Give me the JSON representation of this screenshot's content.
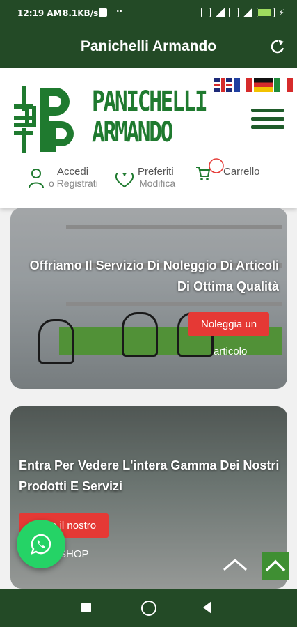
{
  "status_bar": {
    "time": "12:19 AM",
    "speed": "8.1KB/s",
    "dots": "··"
  },
  "app_bar": {
    "title": "Panichelli Armando"
  },
  "header": {
    "brand_line1": "PANICHELLI",
    "brand_line2": "ARMANDO",
    "flags": [
      "uk-flag",
      "fr-flag",
      "de-flag",
      "it-flag"
    ],
    "login": {
      "label": "Accedi",
      "sub": "o Registrati"
    },
    "favorites": {
      "label": "Preferiti",
      "sub": "Modifica"
    },
    "cart": {
      "label": "Carrello"
    }
  },
  "banners": [
    {
      "title": "Offriamo Il Servizio Di Noleggio Di Articoli Di Ottima Qualità",
      "button": "Noleggia un",
      "button_tail": "articolo"
    },
    {
      "title": "Entra Per Vedere L'intera Gamma Dei Nostri Prodotti E Servizi",
      "button": "Visita il nostro",
      "button_tail": "SHOP"
    }
  ],
  "colors": {
    "brand_green": "#234a26",
    "logo_green": "#1f7a2f",
    "cta_red": "#e53935",
    "whatsapp": "#25d366"
  }
}
